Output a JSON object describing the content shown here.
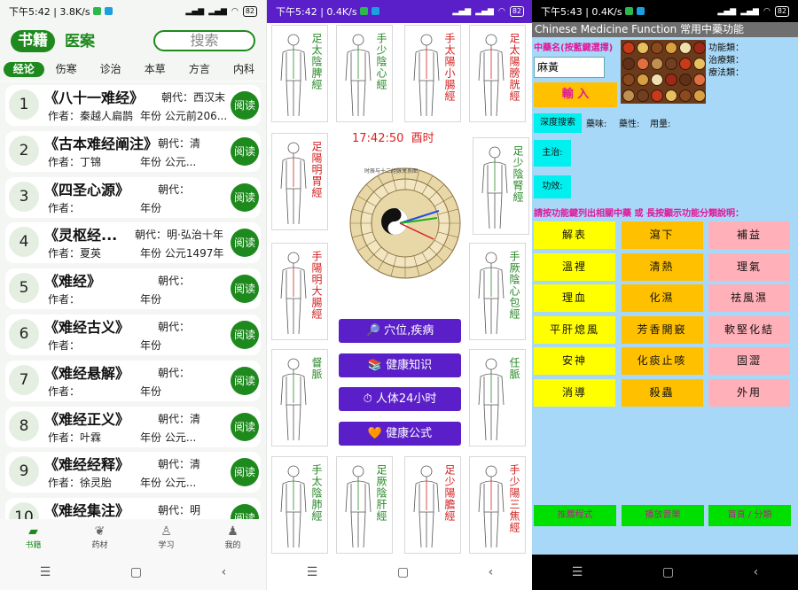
{
  "panel1": {
    "status": {
      "time": "下午5:42",
      "speed": "3.8K/s",
      "battery": "82"
    },
    "tabs": {
      "active": "书籍",
      "other": "医案"
    },
    "search_placeholder": "搜索",
    "categories": [
      {
        "label": "经论",
        "active": true
      },
      {
        "label": "伤寒",
        "active": false
      },
      {
        "label": "诊治",
        "active": false
      },
      {
        "label": "本草",
        "active": false
      },
      {
        "label": "方言",
        "active": false
      },
      {
        "label": "内科",
        "active": false
      }
    ],
    "books": [
      {
        "num": "1",
        "title": "《八十一难经》",
        "dynasty": "朝代：西汉末",
        "author": "作者：秦越人扁鹊",
        "year": "年份 公元前206...",
        "read": "阅读"
      },
      {
        "num": "2",
        "title": "《古本难经阐注》",
        "dynasty": "朝代：清",
        "author": "作者：丁锦",
        "year": "年份 公元...",
        "read": "阅读"
      },
      {
        "num": "3",
        "title": "《四圣心源》",
        "dynasty": "朝代：",
        "author": "作者：",
        "year": "年份",
        "read": "阅读"
      },
      {
        "num": "4",
        "title": "《灵枢经...",
        "dynasty": "朝代：明·弘治十年",
        "author": "作者：夏英",
        "year": "年份 公元1497年",
        "read": "阅读"
      },
      {
        "num": "5",
        "title": "《难经》",
        "dynasty": "朝代：",
        "author": "作者：",
        "year": "年份",
        "read": "阅读"
      },
      {
        "num": "6",
        "title": "《难经古义》",
        "dynasty": "朝代：",
        "author": "作者：",
        "year": "年份",
        "read": "阅读"
      },
      {
        "num": "7",
        "title": "《难经悬解》",
        "dynasty": "朝代：",
        "author": "作者：",
        "year": "年份",
        "read": "阅读"
      },
      {
        "num": "8",
        "title": "《难经正义》",
        "dynasty": "朝代：清",
        "author": "作者：叶霖",
        "year": "年份 公元...",
        "read": "阅读"
      },
      {
        "num": "9",
        "title": "《难经经释》",
        "dynasty": "朝代：清",
        "author": "作者：徐灵胎",
        "year": "年份 公元...",
        "read": "阅读"
      },
      {
        "num": "10",
        "title": "《难经集注》",
        "dynasty": "朝代：明",
        "author": "",
        "year": "",
        "read": "阅读"
      }
    ],
    "bottom_nav": [
      {
        "label": "书籍",
        "icon": "▰",
        "active": true
      },
      {
        "label": "药材",
        "icon": "❦",
        "active": false
      },
      {
        "label": "学习",
        "icon": "♙",
        "active": false
      },
      {
        "label": "我的",
        "icon": "♟",
        "active": false
      }
    ],
    "colors": {
      "accent": "#1e8a1e"
    }
  },
  "panel2": {
    "status": {
      "time": "下午5:42",
      "speed": "0.4K/s",
      "battery": "82"
    },
    "meridians": [
      {
        "label": "足太陰脾經",
        "color": "#2a8a2a"
      },
      {
        "label": "手少陰心經",
        "color": "#2a8a2a"
      },
      {
        "label": "手太陽小腸經",
        "color": "#d22222"
      },
      {
        "label": "足太陽膀胱經",
        "color": "#d22222"
      },
      {
        "label": "足陽明胃經",
        "color": "#d22222"
      },
      {
        "label": "足少陰腎經",
        "color": "#2a8a2a"
      },
      {
        "label": "手陽明大腸經",
        "color": "#d22222"
      },
      {
        "label": "手厥陰心包經",
        "color": "#2a8a2a"
      },
      {
        "label": "督脈",
        "color": "#2a8a2a"
      },
      {
        "label": "任脈",
        "color": "#2a8a2a"
      },
      {
        "label": "手太陰肺經",
        "color": "#2a8a2a"
      },
      {
        "label": "足厥陰肝經",
        "color": "#2a8a2a"
      },
      {
        "label": "足少陽膽經",
        "color": "#d22222"
      },
      {
        "label": "手少陽三焦經",
        "color": "#d22222"
      }
    ],
    "clock": {
      "time": "17:42:50",
      "period": "酉时",
      "caption": "时辰与十二经脉关系图"
    },
    "buttons": [
      {
        "icon": "🔎",
        "label": "穴位,疾病"
      },
      {
        "icon": "📚",
        "label": "健康知识"
      },
      {
        "icon": "⏱",
        "label": "人体24小时"
      },
      {
        "icon": "🧡",
        "label": "健康公式"
      }
    ],
    "colors": {
      "accent": "#5a1fc8"
    }
  },
  "panel3": {
    "status": {
      "time": "下午5:43",
      "speed": "0.4K/s",
      "battery": "82"
    },
    "title": "Chinese Medicine Function 常用中藥功能",
    "herb_name_label": "中藥名(按藍鍵選擇)",
    "herb_value": "麻黃",
    "enter_label": "輸 入",
    "info": {
      "func": "功能類：",
      "treat": "治療類：",
      "method": "療法類："
    },
    "deep_search": "深度搜索",
    "props": {
      "taste": "藥味:",
      "nature": "藥性:",
      "dose": "用量:"
    },
    "main_treat": "主治:",
    "effect": "功效:",
    "instruction": "請按功能鍵列出相關中藥 或 長按顯示功能分類說明：",
    "functions": [
      [
        "解表",
        "瀉下",
        "補益"
      ],
      [
        "溫裡",
        "清熱",
        "理氣"
      ],
      [
        "理血",
        "化濕",
        "祛風濕"
      ],
      [
        "平肝熄風",
        "芳香開竅",
        "軟堅化結"
      ],
      [
        "安神",
        "化痰止咳",
        "固澀"
      ],
      [
        "消導",
        "殺蟲",
        "外用"
      ]
    ],
    "bottom_buttons": [
      "推薦程式",
      "播放音樂",
      "首頁 / 分類"
    ],
    "colors": {
      "bg": "#a8d8f8",
      "magenta": "#e0189a",
      "cyan": "#00f0f0"
    }
  }
}
